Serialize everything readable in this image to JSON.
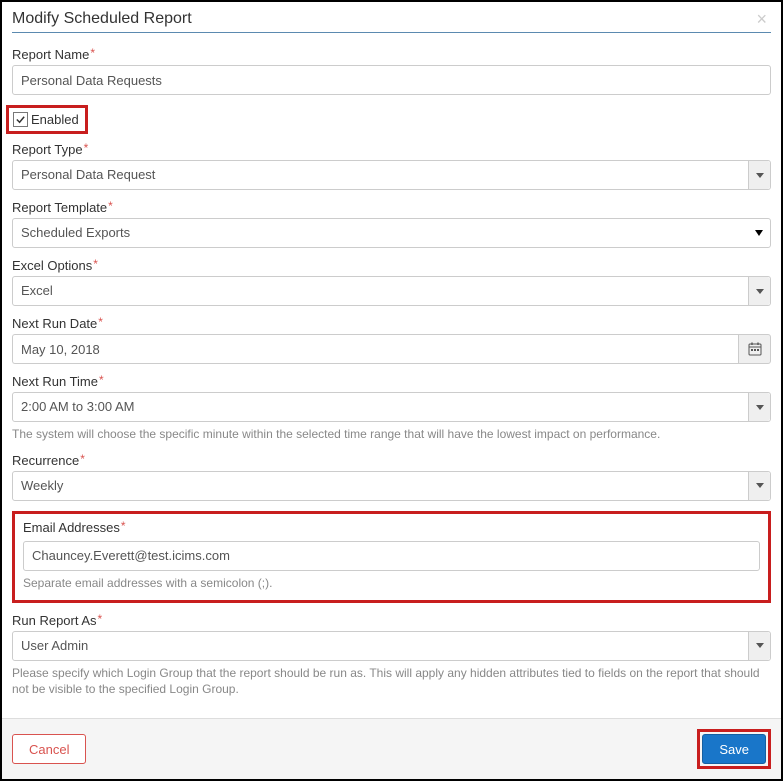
{
  "header": {
    "title": "Modify Scheduled Report"
  },
  "labels": {
    "report_name": "Report Name",
    "enabled": "Enabled",
    "report_type": "Report Type",
    "report_template": "Report Template",
    "excel_options": "Excel Options",
    "next_run_date": "Next Run Date",
    "next_run_time": "Next Run Time",
    "recurrence": "Recurrence",
    "email_addresses": "Email Addresses",
    "run_report_as": "Run Report As"
  },
  "values": {
    "report_name": "Personal Data Requests",
    "enabled": true,
    "report_type": "Personal Data Request",
    "report_template": "Scheduled Exports",
    "excel_options": "Excel",
    "next_run_date": "May 10, 2018",
    "next_run_time": "2:00 AM to 3:00 AM",
    "recurrence": "Weekly",
    "email_addresses": "Chauncey.Everett@test.icims.com",
    "run_report_as": "User Admin"
  },
  "helptext": {
    "next_run_time": "The system will choose the specific minute within the selected time range that will have the lowest impact on performance.",
    "email_addresses": "Separate email addresses with a semicolon (;).",
    "run_report_as": "Please specify which Login Group that the report should be run as. This will apply any hidden attributes tied to fields on the report that should not be visible to the specified Login Group."
  },
  "buttons": {
    "cancel": "Cancel",
    "save": "Save"
  },
  "required_marker": "*"
}
